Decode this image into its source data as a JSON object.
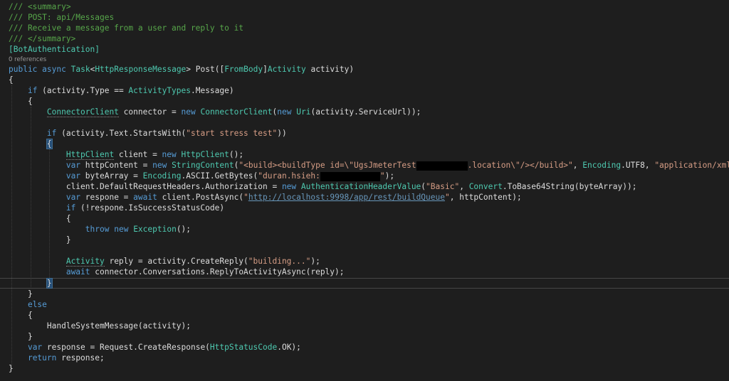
{
  "editor": {
    "doc_comment": {
      "l1": "/// <summary>",
      "l2": "/// POST: api/Messages",
      "l3": "/// Receive a message from a user and reply to it",
      "l4": "/// </summary>"
    },
    "attribute": "[BotAuthentication]",
    "codelens": "0 references",
    "signature": {
      "public": "public",
      "async": "async",
      "task": "Task",
      "lt": "<",
      "resp_msg": "HttpResponseMessage",
      "gt_post": "> Post([",
      "frombody": "FromBody",
      "bracket": "]",
      "activity_type": "Activity",
      "param": " activity)"
    },
    "brace_open": "{",
    "brace_close": "}",
    "if1": {
      "kw": "if",
      "pre": " (activity.Type == ",
      "type": "ActivityTypes",
      "post": ".Message)"
    },
    "connector": {
      "type": "ConnectorClient",
      "mid": " connector = ",
      "new": "new",
      "type2": "ConnectorClient",
      "open": "(",
      "new2": "new",
      "uri": "Uri",
      "rest": "(activity.ServiceUrl));"
    },
    "if2": {
      "kw": "if",
      "pre": " (activity.Text.StartsWith(",
      "str": "\"start stress test\"",
      "post": "))"
    },
    "httpclient": {
      "type": "HttpClient",
      "mid": " client = ",
      "new": "new",
      "type2": "HttpClient",
      "rest": "();"
    },
    "httpcontent": {
      "var": "var",
      "mid": " httpContent = ",
      "new": "new",
      "type": "StringContent",
      "open": "(",
      "str1": "\"<build><buildType id=\\\"UgsJmeterTest",
      "str2": ".location\\\"/></build>\"",
      "comma": ", ",
      "enc": "Encoding",
      "utf8": ".UTF8, ",
      "str3": "\"application/xml\"",
      "end": ");"
    },
    "bytearray": {
      "var": "var",
      "mid": " byteArray = ",
      "enc": "Encoding",
      "ascii": ".ASCII.GetBytes(",
      "str1": "\"duran.hsieh:",
      "str2": "\"",
      "end": ");"
    },
    "authorization": {
      "pre": "client.DefaultRequestHeaders.Authorization = ",
      "new": "new",
      "type": "AuthenticationHeaderValue",
      "open": "(",
      "str": "\"Basic\"",
      "comma": ", ",
      "conv": "Convert",
      "rest": ".ToBase64String(byteArray));"
    },
    "respone": {
      "var": "var",
      "mid": " respone = ",
      "await": "await",
      "call": " client.PostAsync(",
      "quote1": "\"",
      "url": "http://localhost:9998/app/rest/buildQueue",
      "quote2": "\"",
      "end": ", httpContent);"
    },
    "if3": {
      "kw": "if",
      "rest": " (!respone.IsSuccessStatusCode)"
    },
    "throw_stmt": {
      "throw": "throw",
      "new": "new",
      "type": "Exception",
      "rest": "();"
    },
    "reply": {
      "type": "Activity",
      "mid": " reply = activity.CreateReply(",
      "str": "\"building...\"",
      "end": ");"
    },
    "await_reply": {
      "await": "await",
      "rest": " connector.Conversations.ReplyToActivityAsync(reply);"
    },
    "else_kw": "else",
    "handle": "HandleSystemMessage(activity);",
    "response": {
      "var": "var",
      "mid": " response = Request.CreateResponse(",
      "type": "HttpStatusCode",
      "end": ".OK);"
    },
    "return_stmt": {
      "kw": "return",
      "rest": " response;"
    }
  },
  "colors": {
    "background": "#1e1e1e",
    "keyword": "#569cd6",
    "type": "#4ec9b0",
    "string": "#d69d85",
    "comment": "#57a64a",
    "text": "#dcdcdc"
  }
}
